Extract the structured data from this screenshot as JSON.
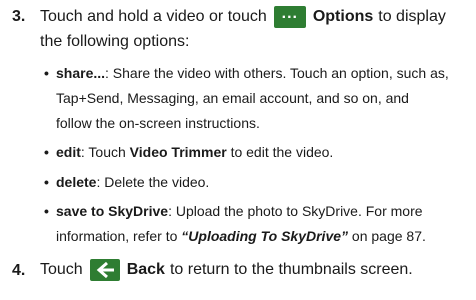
{
  "step3": {
    "number": "3.",
    "intro_pre": "Touch and hold a video or touch",
    "options_icon": "more-options-icon",
    "options_label": "Options",
    "intro_post": "to display",
    "line2": "the following options:",
    "bullets": [
      {
        "term": "share...",
        "line1": ": Share the video with others. Touch an option, such as,",
        "line2": "Tap+Send, Messaging, an email account, and so on, and",
        "line3": "follow the on-screen instructions."
      },
      {
        "term": "edit",
        "pre": ": Touch ",
        "bold_inline": "Video Trimmer",
        "post": " to edit the video."
      },
      {
        "term": "delete",
        "text": ": Delete the video."
      },
      {
        "term": "save to SkyDrive",
        "line1": ": Upload the photo to SkyDrive. For more",
        "line2_pre": "information, refer to ",
        "ref": "“Uploading To SkyDrive”",
        "line2_post": " on page 87."
      }
    ]
  },
  "step4": {
    "number": "4.",
    "pre": "Touch",
    "back_icon": "back-arrow-icon",
    "back_label": "Back",
    "post": "to return to the thumbnails screen."
  },
  "colors": {
    "icon_bg": "#2e7d32",
    "text": "#1a1a1a"
  }
}
